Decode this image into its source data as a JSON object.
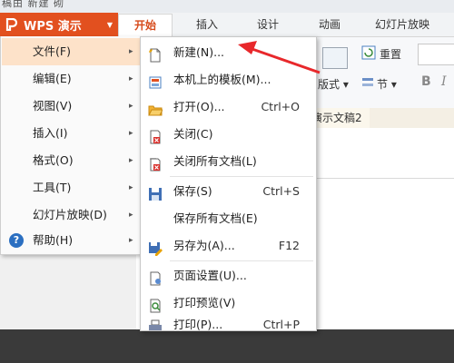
{
  "titlebar": {
    "text": "稿由 新建 砌"
  },
  "app": {
    "name": "WPS 演示"
  },
  "tabs": [
    {
      "label": "开始",
      "active": true
    },
    {
      "label": "插入"
    },
    {
      "label": "设计"
    },
    {
      "label": "动画"
    },
    {
      "label": "幻灯片放映"
    }
  ],
  "toolbar": {
    "reset": "重置",
    "layout": "版式",
    "section": "节",
    "bold": "B",
    "italic": "I"
  },
  "doc_tab": "演示文稿2",
  "main_menu": [
    {
      "label": "文件(F)",
      "highlighted": true
    },
    {
      "label": "编辑(E)"
    },
    {
      "label": "视图(V)"
    },
    {
      "label": "插入(I)"
    },
    {
      "label": "格式(O)"
    },
    {
      "label": "工具(T)"
    },
    {
      "label": "幻灯片放映(D)"
    },
    {
      "label": "帮助(H)"
    }
  ],
  "file_menu": [
    {
      "label": "新建(N)...",
      "shortcut": "",
      "icon": "new-file-icon"
    },
    {
      "label": "本机上的模板(M)...",
      "shortcut": "",
      "icon": "template-icon"
    },
    {
      "label": "打开(O)...",
      "shortcut": "Ctrl+O",
      "icon": "open-folder-icon"
    },
    {
      "label": "关闭(C)",
      "shortcut": "",
      "icon": "close-doc-icon"
    },
    {
      "label": "关闭所有文档(L)",
      "shortcut": "",
      "icon": "close-all-icon"
    },
    {
      "label": "保存(S)",
      "shortcut": "Ctrl+S",
      "icon": "save-icon"
    },
    {
      "label": "保存所有文档(E)",
      "shortcut": "",
      "icon": ""
    },
    {
      "label": "另存为(A)...",
      "shortcut": "F12",
      "icon": "save-as-icon"
    },
    {
      "label": "页面设置(U)...",
      "shortcut": "",
      "icon": "page-setup-icon"
    },
    {
      "label": "打印预览(V)",
      "shortcut": "",
      "icon": "print-preview-icon"
    },
    {
      "label": "打印(P)...",
      "shortcut": "Ctrl+P",
      "icon": "print-icon"
    }
  ],
  "colors": {
    "accent": "#e2501f",
    "highlight": "#fde2c9",
    "arrow": "#e8282b"
  }
}
